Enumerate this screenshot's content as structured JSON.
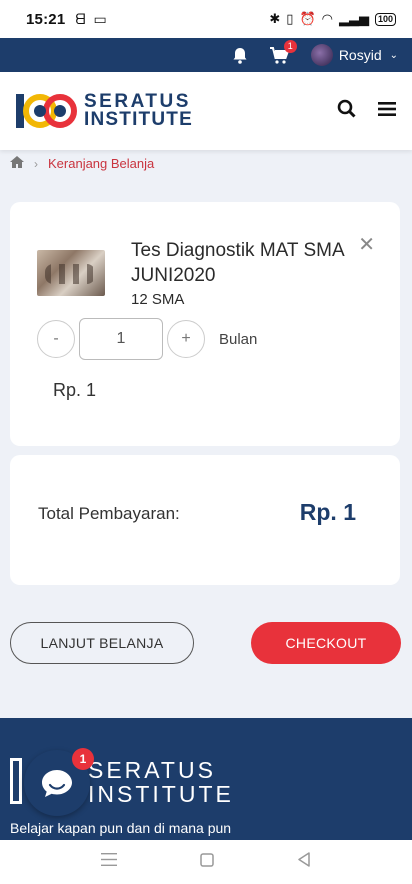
{
  "status_bar": {
    "time": "15:21",
    "battery": "100"
  },
  "topbar": {
    "cart_count": "1",
    "username": "Rosyid"
  },
  "header": {
    "brand_line1": "SERATUS",
    "brand_line2": "INSTITUTE"
  },
  "breadcrumb": {
    "current": "Keranjang Belanja"
  },
  "cart_item": {
    "title": "Tes Diagnostik MAT SMA JUNI2020",
    "subtitle": "12 SMA",
    "decrement_label": "-",
    "increment_label": "+",
    "quantity": "1",
    "unit": "Bulan",
    "price": "Rp. 1"
  },
  "summary": {
    "label": "Total Pembayaran:",
    "value": "Rp. 1"
  },
  "buttons": {
    "continue": "LANJUT BELANJA",
    "checkout": "CHECKOUT"
  },
  "footer": {
    "brand_line1": "SERATUS",
    "brand_line2": "INSTITUTE",
    "tagline": "Belajar kapan pun dan di mana pun",
    "chat_badge": "1"
  },
  "colors": {
    "navy": "#1d3d6b",
    "accent_red": "#e8323b",
    "logo_yellow": "#f2b705"
  }
}
